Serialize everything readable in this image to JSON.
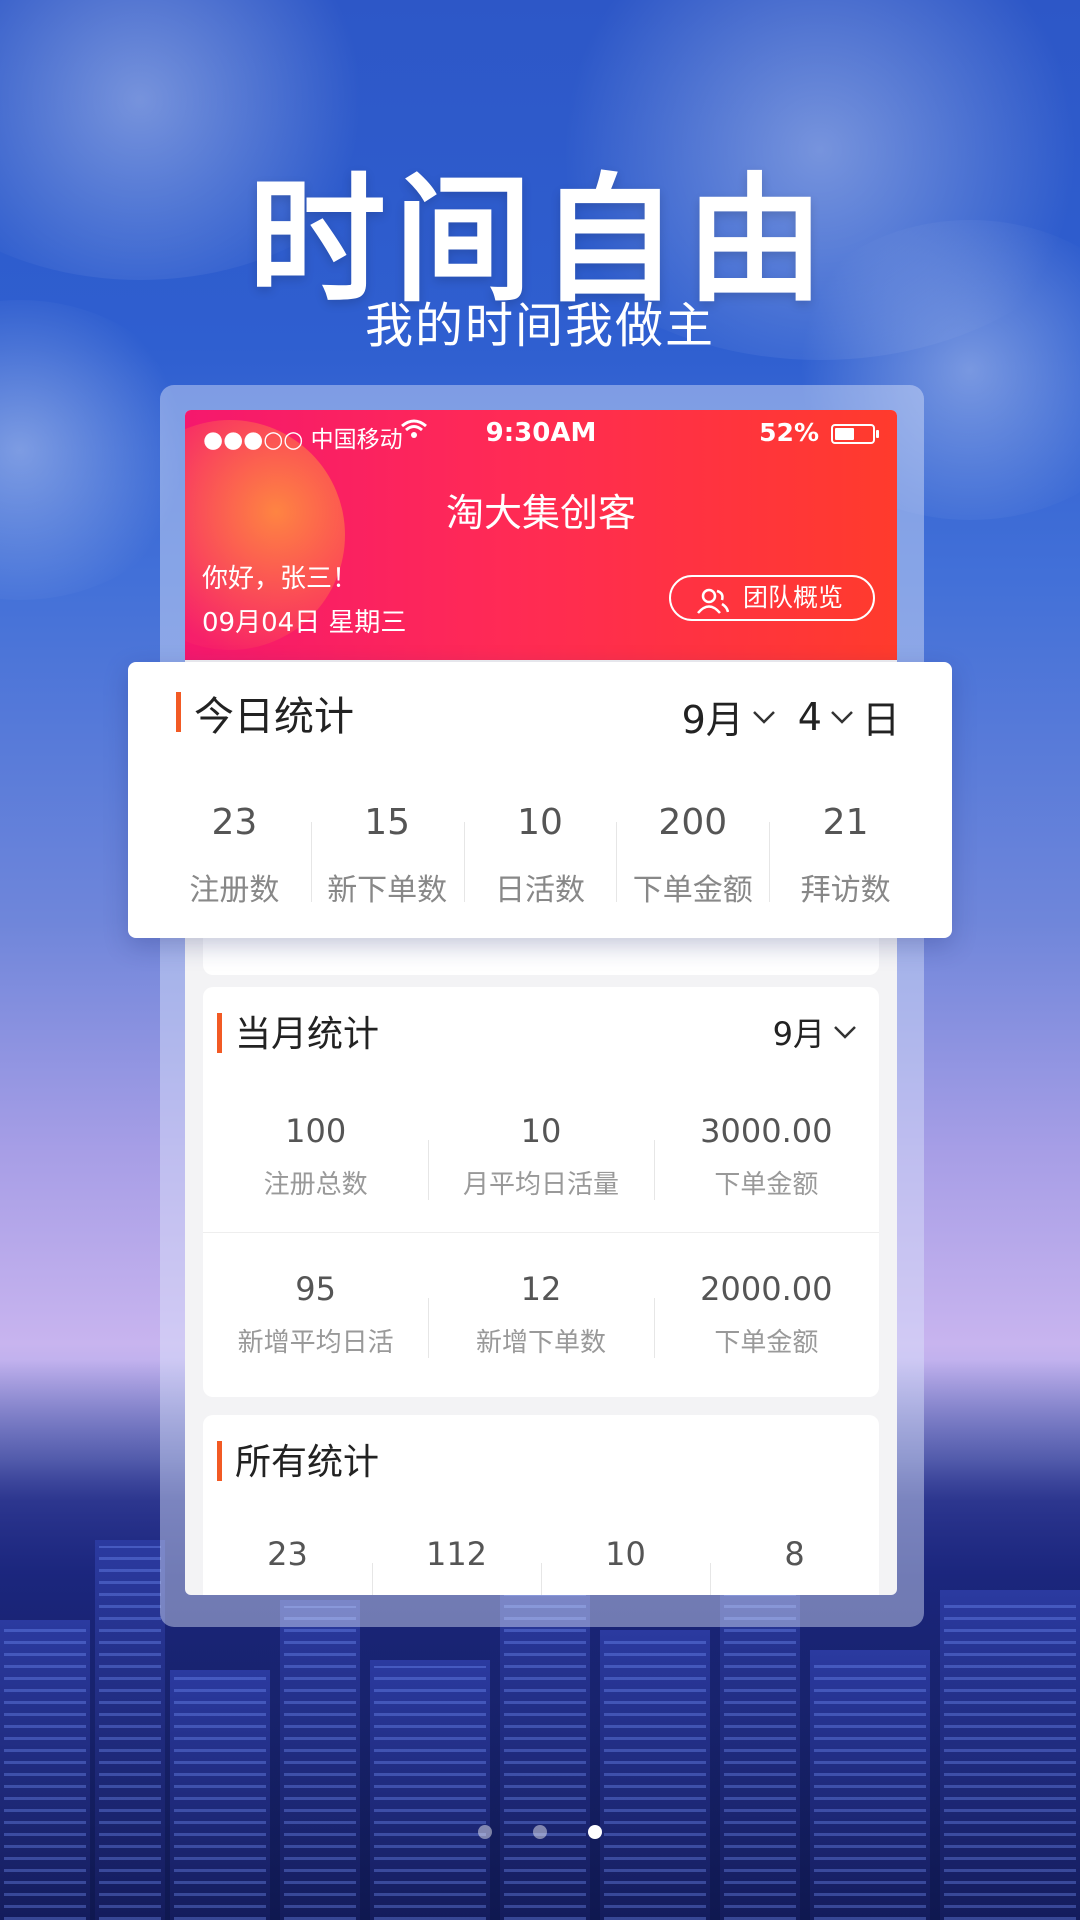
{
  "hero": {
    "title": "时间自由",
    "subtitle": "我的时间我做主"
  },
  "status_bar": {
    "carrier": "●●●○○ 中国移动",
    "time": "9:30AM",
    "battery_percent": "52%",
    "battery_level": 0.52
  },
  "header": {
    "app_title": "淘大集创客",
    "greeting": "你好，张三！",
    "date": "09月04日  星期三",
    "team_button": "团队概览"
  },
  "today": {
    "title": "今日统计",
    "month_select": "9月",
    "day_select": "4",
    "day_suffix": "日",
    "stats": [
      {
        "value": "23",
        "label": "注册数"
      },
      {
        "value": "15",
        "label": "新下单数"
      },
      {
        "value": "10",
        "label": "日活数"
      },
      {
        "value": "200",
        "label": "下单金额"
      },
      {
        "value": "21",
        "label": "拜访数"
      }
    ]
  },
  "month": {
    "title": "当月统计",
    "month_select": "9月",
    "row1": [
      {
        "value": "100",
        "label": "注册总数"
      },
      {
        "value": "10",
        "label": "月平均日活量"
      },
      {
        "value": "3000.00",
        "label": "下单金额"
      }
    ],
    "row2": [
      {
        "value": "95",
        "label": "新增平均日活"
      },
      {
        "value": "12",
        "label": "新增下单数"
      },
      {
        "value": "2000.00",
        "label": "下单金额"
      }
    ]
  },
  "all": {
    "title": "所有统计",
    "stats": [
      "23",
      "112",
      "10",
      "8"
    ]
  },
  "pager": {
    "count": 3,
    "active": 3
  },
  "colors": {
    "accent": "#f25a24",
    "header_start": "#f5186d",
    "header_end": "#ff3b2c"
  }
}
